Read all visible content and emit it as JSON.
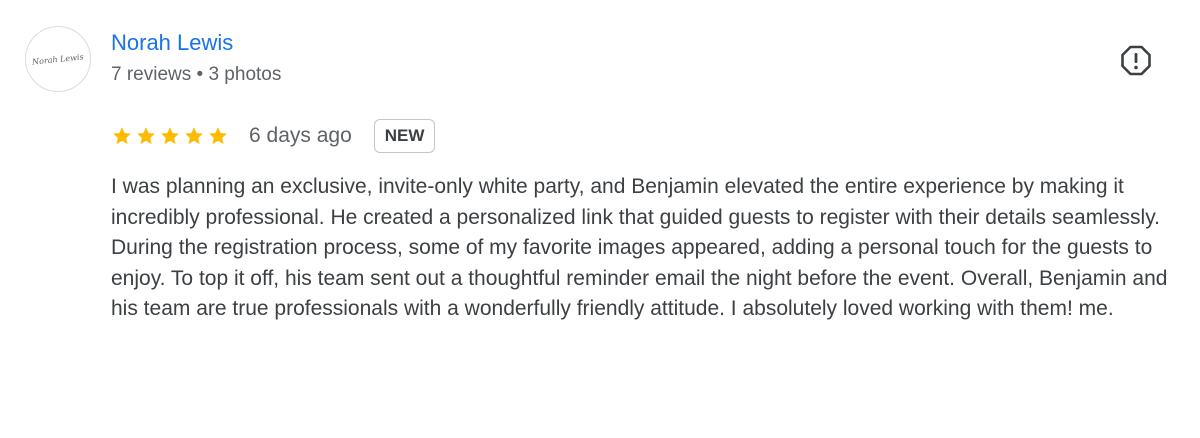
{
  "reviewer": {
    "name": "Norah Lewis",
    "meta": "7 reviews • 3 photos",
    "avatar_signature": "Norah Lewis"
  },
  "review": {
    "rating": 5,
    "rating_max": 5,
    "date": "6 days ago",
    "badge": "NEW",
    "text": "I was planning an exclusive, invite-only white party, and Benjamin elevated the entire experience by making it incredibly professional. He created a personalized link that guided guests to register with their details seamlessly. During the registration process, some of my favorite images appeared, adding a personal touch for the guests to enjoy. To top it off, his team sent out a thoughtful reminder email the night before the event. Overall, Benjamin and his team are true professionals with a wonderfully friendly attitude. I absolutely loved working with them! me."
  },
  "icons": {
    "star": "star-icon",
    "report": "report-flag-icon"
  },
  "colors": {
    "name_link": "#1a73e8",
    "star": "#fbbc04",
    "secondary_text": "#5f6368",
    "body_text": "#3c4043"
  }
}
